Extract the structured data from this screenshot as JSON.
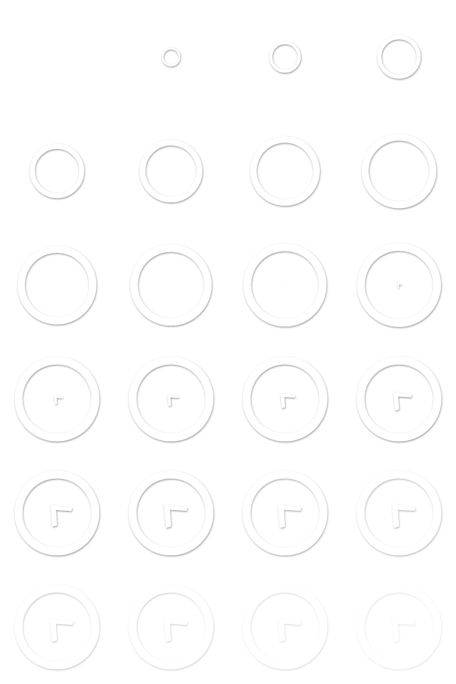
{
  "sheet": {
    "name": "clock-sprite-sheet",
    "columns": 4,
    "rows": 6,
    "background": "#ffffff",
    "ring_color": "#ffffff",
    "shadow_color": "#000000"
  },
  "icon": "clock-icon",
  "frames": [
    {
      "ring_scale": 0.0,
      "hand_scale": 0.0,
      "opacity": 0.0
    },
    {
      "ring_scale": 0.22,
      "hand_scale": 0.0,
      "opacity": 1.0
    },
    {
      "ring_scale": 0.37,
      "hand_scale": 0.0,
      "opacity": 1.0
    },
    {
      "ring_scale": 0.51,
      "hand_scale": 0.0,
      "opacity": 1.0
    },
    {
      "ring_scale": 0.64,
      "hand_scale": 0.0,
      "opacity": 1.0
    },
    {
      "ring_scale": 0.74,
      "hand_scale": 0.0,
      "opacity": 1.0
    },
    {
      "ring_scale": 0.82,
      "hand_scale": 0.0,
      "opacity": 1.0
    },
    {
      "ring_scale": 0.88,
      "hand_scale": 0.0,
      "opacity": 1.0
    },
    {
      "ring_scale": 0.93,
      "hand_scale": 0.0,
      "opacity": 1.0
    },
    {
      "ring_scale": 0.96,
      "hand_scale": 0.0,
      "opacity": 1.0
    },
    {
      "ring_scale": 0.98,
      "hand_scale": 0.04,
      "opacity": 1.0
    },
    {
      "ring_scale": 0.99,
      "hand_scale": 0.2,
      "opacity": 1.0
    },
    {
      "ring_scale": 1.0,
      "hand_scale": 0.35,
      "opacity": 1.0
    },
    {
      "ring_scale": 1.0,
      "hand_scale": 0.48,
      "opacity": 1.0
    },
    {
      "ring_scale": 1.0,
      "hand_scale": 0.62,
      "opacity": 1.0
    },
    {
      "ring_scale": 1.0,
      "hand_scale": 0.78,
      "opacity": 1.0
    },
    {
      "ring_scale": 1.0,
      "hand_scale": 0.92,
      "opacity": 1.0
    },
    {
      "ring_scale": 1.0,
      "hand_scale": 1.0,
      "opacity": 1.0
    },
    {
      "ring_scale": 1.0,
      "hand_scale": 1.0,
      "opacity": 0.85
    },
    {
      "ring_scale": 1.0,
      "hand_scale": 1.0,
      "opacity": 0.7
    },
    {
      "ring_scale": 1.0,
      "hand_scale": 1.0,
      "opacity": 0.55
    },
    {
      "ring_scale": 1.0,
      "hand_scale": 1.0,
      "opacity": 0.45
    },
    {
      "ring_scale": 1.0,
      "hand_scale": 1.0,
      "opacity": 0.35
    },
    {
      "ring_scale": 1.0,
      "hand_scale": 1.0,
      "opacity": 0.25
    }
  ]
}
